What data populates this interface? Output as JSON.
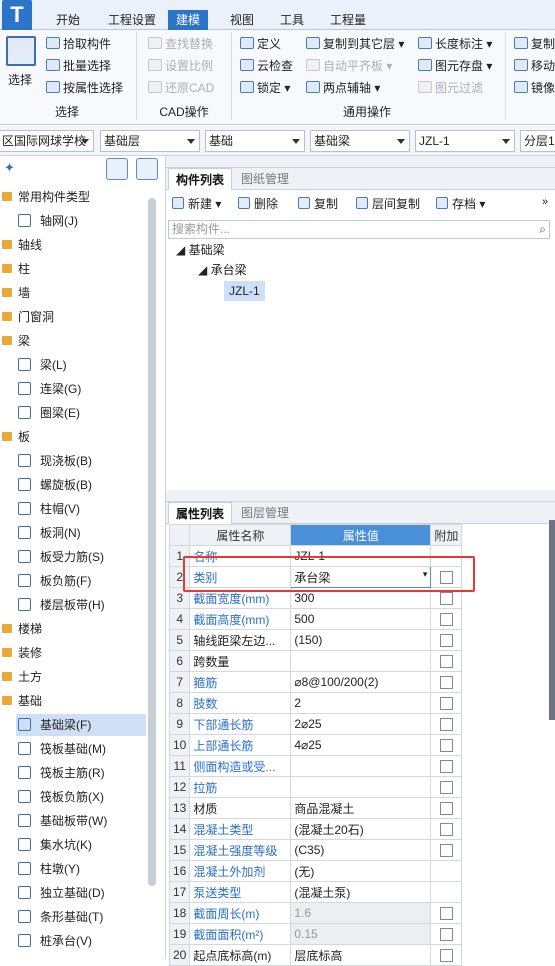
{
  "menu": {
    "app_glyph": "T",
    "tabs": [
      "开始",
      "工程设置",
      "建模",
      "视图",
      "工具",
      "工程量"
    ],
    "active_tab": "建模"
  },
  "ribbon": {
    "select_label": "选择",
    "pick_component": "拾取构件",
    "batch_select": "批量选择",
    "select_by_property": "按属性选择",
    "find_replace": "查找替换",
    "set_scale": "设置比例",
    "restore_cad": "还原CAD",
    "define": "定义",
    "cloud_check": "云检查",
    "lock": "锁定",
    "copy_to_other_floor": "复制到其它层",
    "auto_level_slab": "自动平齐板",
    "two_point_aux": "两点辅轴",
    "length_dimension": "长度标注",
    "element_save": "图元存盘",
    "element_filter": "图元过滤",
    "copy": "复制",
    "move": "移动",
    "mirror": "镜像",
    "group_select": "选择",
    "group_cad": "CAD操作",
    "group_common": "通用操作"
  },
  "selectors": {
    "project": "区国际网球学校",
    "floor": "基础层",
    "category": "基础",
    "type": "基础梁",
    "component": "JZL-1",
    "split": "分层1"
  },
  "left_nav": {
    "items": [
      {
        "label": "常用构件类型",
        "kind": "cat"
      },
      {
        "label": "轴网(J)",
        "kind": "sub"
      },
      {
        "label": "轴线",
        "kind": "cat"
      },
      {
        "label": "柱",
        "kind": "cat"
      },
      {
        "label": "墙",
        "kind": "cat"
      },
      {
        "label": "门窗洞",
        "kind": "cat"
      },
      {
        "label": "梁",
        "kind": "cat"
      },
      {
        "label": "梁(L)",
        "kind": "sub"
      },
      {
        "label": "连梁(G)",
        "kind": "sub"
      },
      {
        "label": "圈梁(E)",
        "kind": "sub"
      },
      {
        "label": "板",
        "kind": "cat"
      },
      {
        "label": "现浇板(B)",
        "kind": "sub"
      },
      {
        "label": "螺旋板(B)",
        "kind": "sub"
      },
      {
        "label": "柱帽(V)",
        "kind": "sub"
      },
      {
        "label": "板洞(N)",
        "kind": "sub"
      },
      {
        "label": "板受力筋(S)",
        "kind": "sub"
      },
      {
        "label": "板负筋(F)",
        "kind": "sub"
      },
      {
        "label": "楼层板带(H)",
        "kind": "sub"
      },
      {
        "label": "楼梯",
        "kind": "cat"
      },
      {
        "label": "装修",
        "kind": "cat"
      },
      {
        "label": "土方",
        "kind": "cat"
      },
      {
        "label": "基础",
        "kind": "cat"
      },
      {
        "label": "基础梁(F)",
        "kind": "sub"
      },
      {
        "label": "筏板基础(M)",
        "kind": "sub"
      },
      {
        "label": "筏板主筋(R)",
        "kind": "sub"
      },
      {
        "label": "筏板负筋(X)",
        "kind": "sub"
      },
      {
        "label": "基础板带(W)",
        "kind": "sub"
      },
      {
        "label": "集水坑(K)",
        "kind": "sub"
      },
      {
        "label": "柱墩(Y)",
        "kind": "sub"
      },
      {
        "label": "独立基础(D)",
        "kind": "sub"
      },
      {
        "label": "条形基础(T)",
        "kind": "sub"
      },
      {
        "label": "桩承台(V)",
        "kind": "sub"
      }
    ],
    "selected_label": "基础梁(F)"
  },
  "component_panel": {
    "tab_active": "构件列表",
    "tab_other": "图纸管理",
    "toolbar": {
      "new": "新建",
      "delete": "删除",
      "copy": "复制",
      "floor_copy": "层间复制",
      "archive": "存档"
    },
    "search_placeholder": "搜索构件...",
    "tree": {
      "root": "基础梁",
      "child": "承台梁",
      "leaf": "JZL-1"
    }
  },
  "property_panel": {
    "tab_active": "属性列表",
    "tab_other": "图层管理",
    "headers": {
      "name": "属性名称",
      "value": "属性值",
      "add": "附加"
    },
    "rows": [
      {
        "num": "1",
        "name": "名称",
        "value": "JZL-1",
        "blue": true,
        "checkbox": false,
        "grey": false
      },
      {
        "num": "2",
        "name": "类别",
        "value": "承台梁",
        "blue": true,
        "checkbox": true,
        "grey": false,
        "dropdown": true
      },
      {
        "num": "3",
        "name": "截面宽度(mm)",
        "value": "300",
        "blue": true,
        "checkbox": true,
        "grey": false
      },
      {
        "num": "4",
        "name": "截面高度(mm)",
        "value": "500",
        "blue": true,
        "checkbox": true,
        "grey": false
      },
      {
        "num": "5",
        "name": "轴线距梁左边...",
        "value": "(150)",
        "blue": false,
        "checkbox": true,
        "grey": false
      },
      {
        "num": "6",
        "name": "跨数量",
        "value": "",
        "blue": false,
        "checkbox": true,
        "grey": false
      },
      {
        "num": "7",
        "name": "箍筋",
        "value": "⌀8@100/200(2)",
        "blue": true,
        "checkbox": true,
        "grey": false
      },
      {
        "num": "8",
        "name": "肢数",
        "value": "2",
        "blue": true,
        "checkbox": true,
        "grey": false
      },
      {
        "num": "9",
        "name": "下部通长筋",
        "value": "2⌀25",
        "blue": true,
        "checkbox": true,
        "grey": false
      },
      {
        "num": "10",
        "name": "上部通长筋",
        "value": "4⌀25",
        "blue": true,
        "checkbox": true,
        "grey": false
      },
      {
        "num": "11",
        "name": "侧面构造或受...",
        "value": "",
        "blue": true,
        "checkbox": true,
        "grey": false
      },
      {
        "num": "12",
        "name": "拉筋",
        "value": "",
        "blue": true,
        "checkbox": true,
        "grey": false
      },
      {
        "num": "13",
        "name": "材质",
        "value": "商品混凝土",
        "blue": false,
        "checkbox": true,
        "grey": false
      },
      {
        "num": "14",
        "name": "混凝土类型",
        "value": "(混凝土20石)",
        "blue": true,
        "checkbox": true,
        "grey": false
      },
      {
        "num": "15",
        "name": "混凝土强度等级",
        "value": "(C35)",
        "blue": true,
        "checkbox": true,
        "grey": false
      },
      {
        "num": "16",
        "name": "混凝土外加剂",
        "value": "(无)",
        "blue": true,
        "checkbox": false,
        "grey": false
      },
      {
        "num": "17",
        "name": "泵送类型",
        "value": "(混凝土泵)",
        "blue": true,
        "checkbox": false,
        "grey": false
      },
      {
        "num": "18",
        "name": "截面周长(m)",
        "value": "1.6",
        "blue": true,
        "checkbox": true,
        "grey": true
      },
      {
        "num": "19",
        "name": "截面面积(m²)",
        "value": "0.15",
        "blue": true,
        "checkbox": true,
        "grey": true
      },
      {
        "num": "20",
        "name": "起点底标高(m)",
        "value": "层底标高",
        "blue": false,
        "checkbox": true,
        "grey": false
      }
    ]
  }
}
